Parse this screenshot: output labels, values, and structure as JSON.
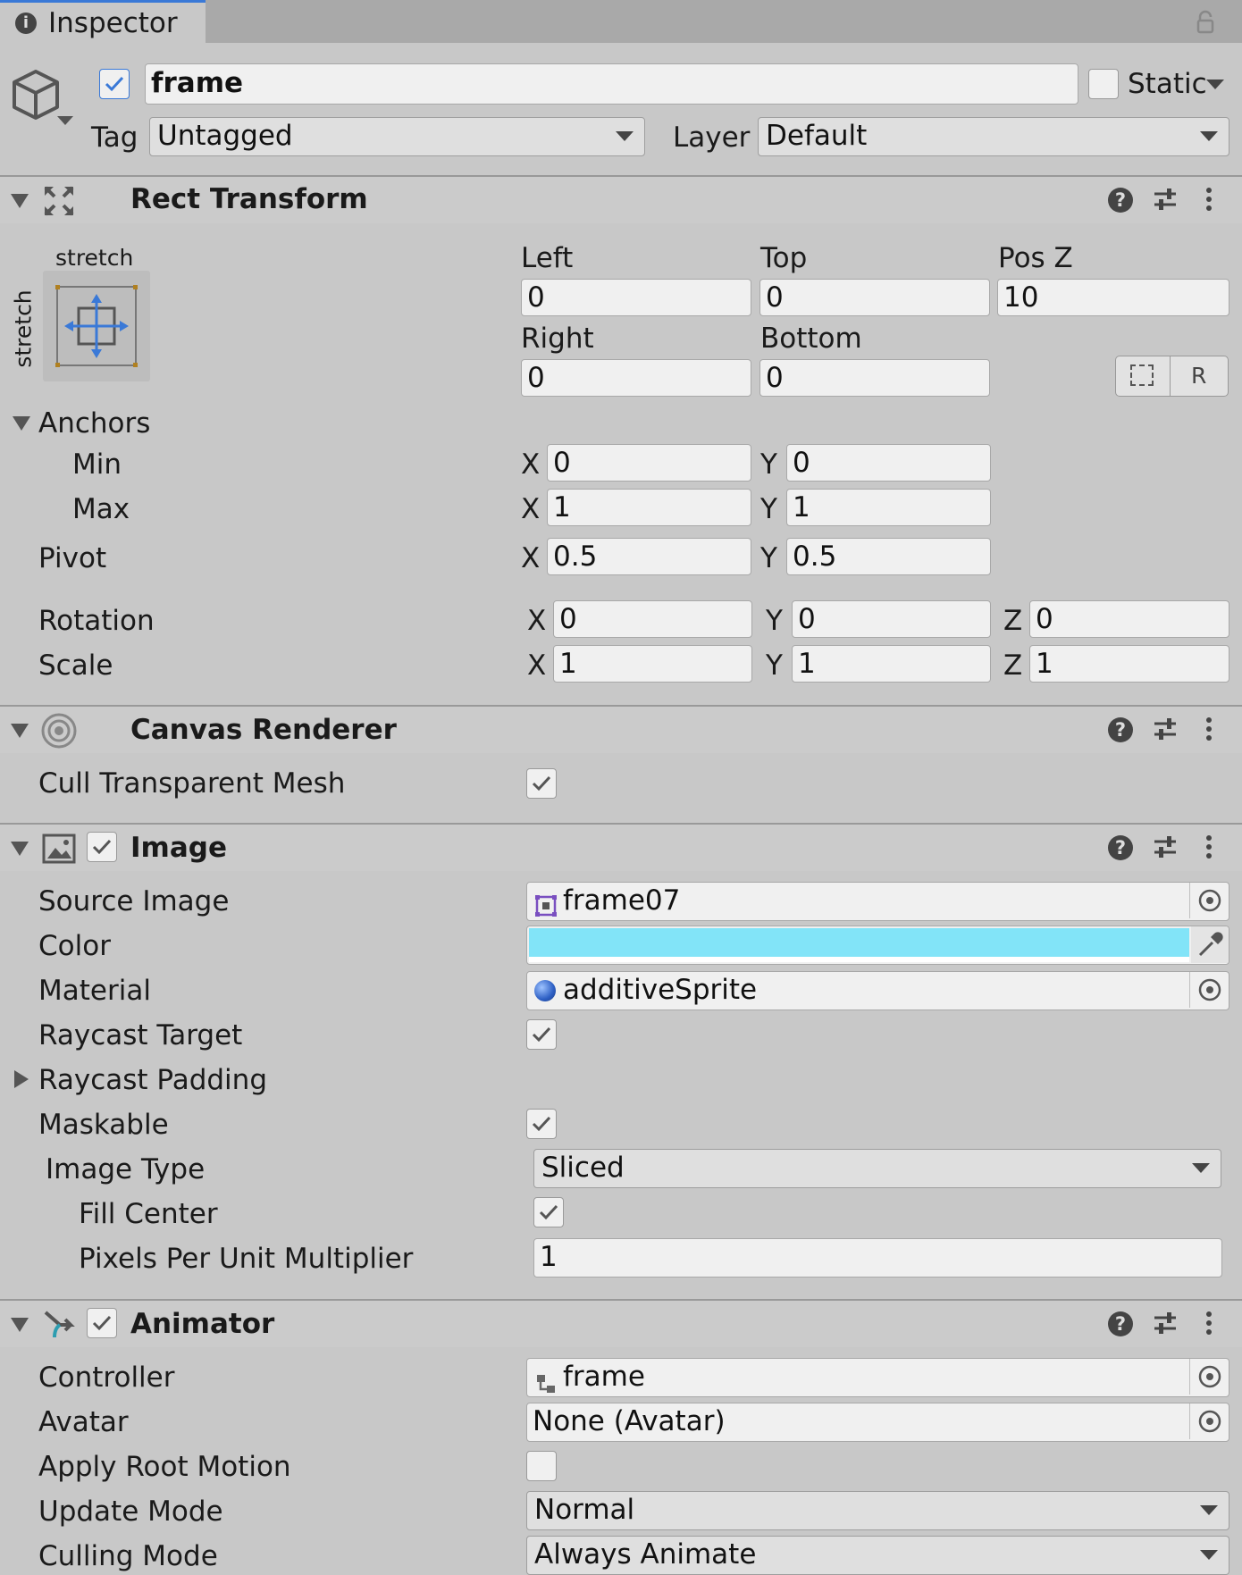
{
  "tab": {
    "title": "Inspector"
  },
  "gameobject": {
    "name": "frame",
    "static_label": "Static",
    "tag_label": "Tag",
    "tag_value": "Untagged",
    "layer_label": "Layer",
    "layer_value": "Default"
  },
  "rect_transform": {
    "title": "Rect Transform",
    "anchor_preset_h": "stretch",
    "anchor_preset_v": "stretch",
    "left_label": "Left",
    "left": "0",
    "top_label": "Top",
    "top": "0",
    "posz_label": "Pos Z",
    "posz": "10",
    "right_label": "Right",
    "right": "0",
    "bottom_label": "Bottom",
    "bottom": "0",
    "raw_button": "R",
    "anchors_label": "Anchors",
    "min_label": "Min",
    "min_x": "0",
    "min_y": "0",
    "max_label": "Max",
    "max_x": "1",
    "max_y": "1",
    "pivot_label": "Pivot",
    "pivot_x": "0.5",
    "pivot_y": "0.5",
    "rotation_label": "Rotation",
    "rot_x": "0",
    "rot_y": "0",
    "rot_z": "0",
    "scale_label": "Scale",
    "scale_x": "1",
    "scale_y": "1",
    "scale_z": "1",
    "x": "X",
    "y": "Y",
    "z": "Z"
  },
  "canvas_renderer": {
    "title": "Canvas Renderer",
    "cull_label": "Cull Transparent Mesh",
    "cull_checked": true
  },
  "image": {
    "title": "Image",
    "source_label": "Source Image",
    "source_value": "frame07",
    "color_label": "Color",
    "color_value": "#82e4f8",
    "material_label": "Material",
    "material_value": "additiveSprite",
    "raycast_target_label": "Raycast Target",
    "raycast_padding_label": "Raycast Padding",
    "maskable_label": "Maskable",
    "image_type_label": "Image Type",
    "image_type_value": "Sliced",
    "fill_center_label": "Fill Center",
    "ppu_label": "Pixels Per Unit Multiplier",
    "ppu_value": "1"
  },
  "animator": {
    "title": "Animator",
    "controller_label": "Controller",
    "controller_value": "frame",
    "avatar_label": "Avatar",
    "avatar_value": "None (Avatar)",
    "apply_root_label": "Apply Root Motion",
    "update_mode_label": "Update Mode",
    "update_mode_value": "Normal",
    "culling_label": "Culling Mode",
    "culling_value": "Always Animate"
  },
  "icons": [
    "info-icon",
    "lock-icon",
    "gameobject-cube-icon",
    "rect-transform-icon",
    "canvas-renderer-icon",
    "image-component-icon",
    "animator-icon",
    "help-icon",
    "presets-icon",
    "more-icon",
    "object-picker-icon",
    "eyedropper-icon",
    "sprite-icon",
    "material-icon",
    "animator-controller-icon",
    "blueprint-icon"
  ]
}
